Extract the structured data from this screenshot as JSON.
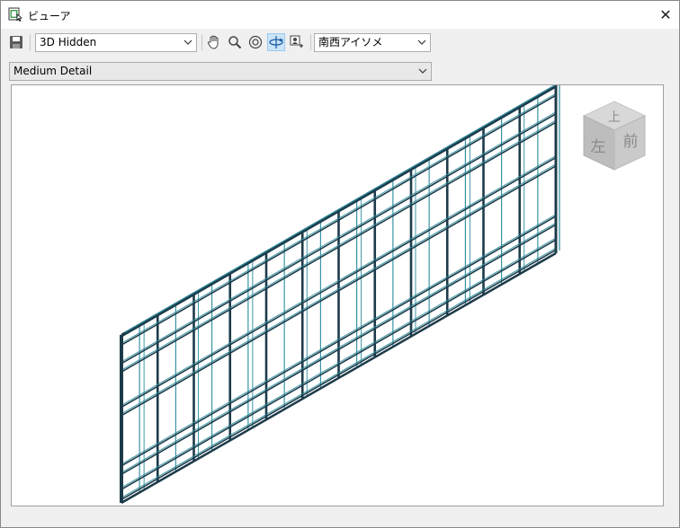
{
  "window": {
    "title": "ビューア",
    "close_label": "✕"
  },
  "toolbar": {
    "visual_style": "3D Hidden",
    "view_orientation": "南西アイソメ"
  },
  "detail_level": "Medium Detail",
  "viewcube": {
    "top_label": "上",
    "left_label": "左",
    "front_label": "前"
  },
  "colors": {
    "frame_dark": "#1d3b4a",
    "panel_line": "#2a8c9c",
    "active_button": "#cce4f7"
  }
}
